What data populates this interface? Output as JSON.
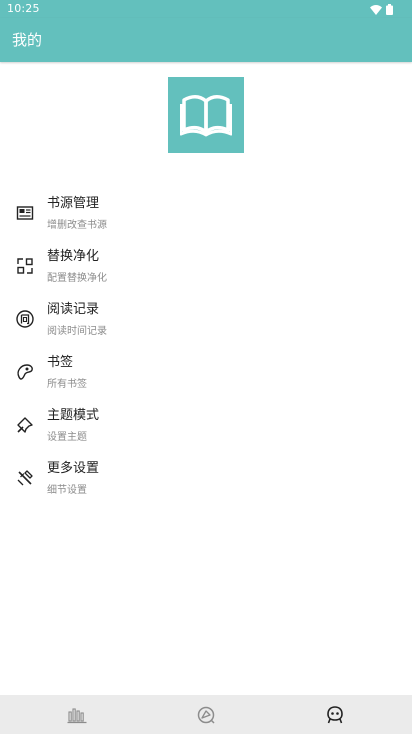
{
  "status_bar": {
    "time": "10:25",
    "icons": [
      "wifi-icon",
      "battery-icon"
    ]
  },
  "app_bar": {
    "title": "我的"
  },
  "header": {
    "logo_icon": "book-icon",
    "logo_bg_color": "#63c0bd"
  },
  "menu": {
    "items": [
      {
        "icon": "book-source-icon",
        "title": "书源管理",
        "subtitle": "增删改查书源"
      },
      {
        "icon": "replace-icon",
        "title": "替换净化",
        "subtitle": "配置替换净化"
      },
      {
        "icon": "read-record-icon",
        "title": "阅读记录",
        "subtitle": "阅读时间记录"
      },
      {
        "icon": "bookmark-icon",
        "title": "书签",
        "subtitle": "所有书签"
      },
      {
        "icon": "theme-icon",
        "title": "主题模式",
        "subtitle": "设置主题"
      },
      {
        "icon": "settings-icon",
        "title": "更多设置",
        "subtitle": "细节设置"
      }
    ]
  },
  "bottom_nav": {
    "tabs": [
      {
        "icon": "bookshelf-icon",
        "active": false
      },
      {
        "icon": "discover-icon",
        "active": false
      },
      {
        "icon": "my-icon",
        "active": true
      }
    ]
  },
  "colors": {
    "primary": "#63c0bd",
    "text_primary": "#222222",
    "text_secondary": "#8c8c8c",
    "nav_background": "#ebebeb"
  }
}
